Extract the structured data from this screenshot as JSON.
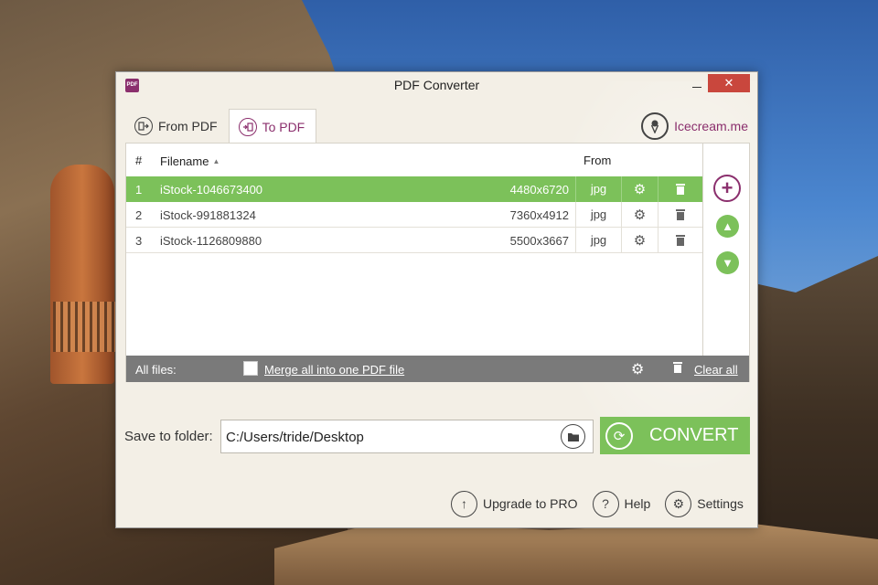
{
  "window": {
    "title": "PDF Converter",
    "close_glyph": "✕",
    "app_icon_label": "PDF"
  },
  "tabs": [
    {
      "label": "From PDF",
      "icon": "from-pdf-icon",
      "active": false
    },
    {
      "label": "To PDF",
      "icon": "to-pdf-icon",
      "active": true
    }
  ],
  "brand": {
    "label": "Icecream.me"
  },
  "table": {
    "headers": {
      "num": "#",
      "filename": "Filename",
      "from": "From"
    },
    "rows": [
      {
        "num": "1",
        "name": "iStock-1046673400",
        "resolution": "4480x6720",
        "format": "jpg",
        "selected": true
      },
      {
        "num": "2",
        "name": "iStock-991881324",
        "resolution": "7360x4912",
        "format": "jpg",
        "selected": false
      },
      {
        "num": "3",
        "name": "iStock-1126809880",
        "resolution": "5500x3667",
        "format": "jpg",
        "selected": false
      }
    ]
  },
  "all_files": {
    "label": "All files:",
    "merge_label": "Merge all into one PDF file",
    "merge_checked": false,
    "clear_label": "Clear all"
  },
  "save": {
    "label": "Save to folder:",
    "path": "C:/Users/tride/Desktop"
  },
  "convert": {
    "label": "CONVERT"
  },
  "footer": {
    "upgrade": "Upgrade to PRO",
    "help": "Help",
    "settings": "Settings"
  },
  "colors": {
    "accent": "#8b2f6d",
    "green": "#7cc15a",
    "bar": "#7a7a7a",
    "close": "#c9473d"
  }
}
